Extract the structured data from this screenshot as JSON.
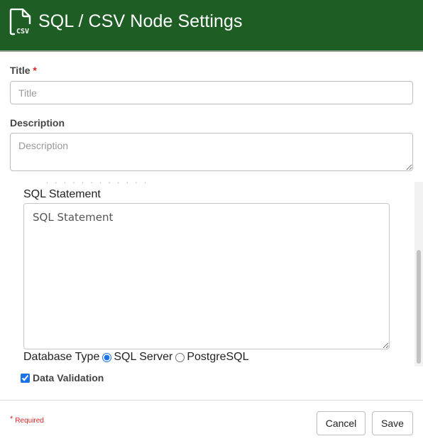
{
  "header": {
    "icon": "csv-file-icon",
    "title": "SQL / CSV Node Settings",
    "icon_text": "CSV"
  },
  "form": {
    "title_label": "Title",
    "title_required_mark": "*",
    "title_placeholder": "Title",
    "title_value": "",
    "description_label": "Description",
    "description_placeholder": "Description",
    "description_value": ""
  },
  "panel": {
    "clipped_text": "· · · · · · · · · · · ·",
    "sql_label": "SQL Statement",
    "sql_placeholder": "SQL Statement",
    "sql_value": "",
    "db_type_label": "Database Type",
    "db_options": [
      "SQL Server",
      "PostgreSQL"
    ],
    "db_selected": "SQL Server"
  },
  "data_validation": {
    "label": "Data Validation",
    "checked": true
  },
  "footer": {
    "required_mark": "*",
    "required_text": "Required",
    "cancel_label": "Cancel",
    "save_label": "Save"
  },
  "colors": {
    "header_bg": "#1e5e25",
    "required": "#dd2222"
  }
}
